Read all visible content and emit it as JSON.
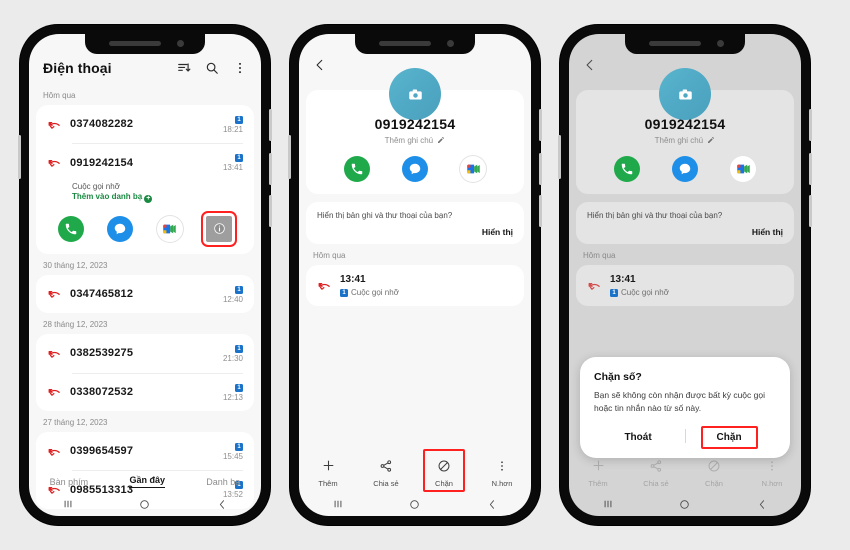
{
  "background_color": "#ebebeb",
  "accent": {
    "green": "#1fa94b",
    "blue": "#1e8fe8",
    "teal_avatar": "#4fa8c4",
    "red_highlight": "#ff2020",
    "sim_badge_blue": "#1a73c8",
    "add_contact_green": "#1a8a42"
  },
  "phone1": {
    "app_title": "Điện thoại",
    "header_icons": [
      "sort-icon",
      "search-icon",
      "overflow-menu-icon"
    ],
    "groups": [
      {
        "date": "Hôm qua",
        "entries": [
          {
            "number": "0374082282",
            "sim": "1",
            "time": "18:21",
            "type": "missed-call-icon",
            "expanded": false
          },
          {
            "number": "0919242154",
            "sim": "1",
            "time": "13:41",
            "type": "missed-call-icon",
            "expanded": true,
            "sub_label": "Cuộc gọi nhỡ",
            "add_contact": "Thêm vào danh bạ",
            "actions": [
              "call-icon",
              "message-icon",
              "google-meet-icon",
              "info-icon"
            ],
            "highlighted_action": "info-icon"
          }
        ]
      },
      {
        "date": "30 tháng 12, 2023",
        "entries": [
          {
            "number": "0347465812",
            "sim": "1",
            "time": "12:40",
            "type": "missed-call-icon",
            "expanded": false
          }
        ]
      },
      {
        "date": "28 tháng 12, 2023",
        "entries": [
          {
            "number": "0382539275",
            "sim": "1",
            "time": "21:30",
            "type": "missed-call-icon",
            "expanded": false
          },
          {
            "number": "0338072532",
            "sim": "1",
            "time": "12:13",
            "type": "missed-call-icon",
            "expanded": false
          }
        ]
      },
      {
        "date": "27 tháng 12, 2023",
        "entries": [
          {
            "number": "0399654597",
            "sim": "1",
            "time": "15:45",
            "type": "missed-call-icon",
            "expanded": false
          },
          {
            "number": "0985513313",
            "sim": "1",
            "time": "13:52",
            "type": "missed-call-icon",
            "expanded": false
          }
        ]
      }
    ],
    "tabs": [
      {
        "label": "Bàn phím",
        "active": false
      },
      {
        "label": "Gần đây",
        "active": true
      },
      {
        "label": "Danh bạ",
        "active": false
      }
    ]
  },
  "phone2": {
    "back": "back-arrow-icon",
    "avatar_icon": "camera-icon",
    "number": "0919242154",
    "note_label": "Thêm ghi chú",
    "note_icon": "pencil-icon",
    "quick_actions": [
      "call-icon",
      "message-icon",
      "google-meet-icon"
    ],
    "voicemail_prompt": "Hiển thị bản ghi và thư thoại của bạn?",
    "voicemail_button": "Hiển thị",
    "log_date": "Hôm qua",
    "log_time": "13:41",
    "log_type": "Cuộc gọi nhỡ",
    "log_sim": "1",
    "bottom_actions": [
      {
        "label": "Thêm",
        "icon": "plus-icon",
        "highlighted": false
      },
      {
        "label": "Chia sẻ",
        "icon": "share-icon",
        "highlighted": false
      },
      {
        "label": "Chặn",
        "icon": "block-icon",
        "highlighted": true
      },
      {
        "label": "N.hơn",
        "icon": "more-vertical-icon",
        "highlighted": false
      }
    ]
  },
  "phone3": {
    "back": "back-arrow-icon",
    "avatar_icon": "camera-icon",
    "number": "0919242154",
    "note_label": "Thêm ghi chú",
    "note_icon": "pencil-icon",
    "quick_actions": [
      "call-icon",
      "message-icon",
      "google-meet-icon"
    ],
    "voicemail_prompt": "Hiển thị bản ghi và thư thoại của bạn?",
    "voicemail_button": "Hiển thị",
    "log_date": "Hôm qua",
    "log_time": "13:41",
    "log_type": "Cuộc gọi nhỡ",
    "log_sim": "1",
    "dialog": {
      "title": "Chặn số?",
      "body": "Bạn sẽ không còn nhận được bất kỳ cuộc gọi hoặc tin nhắn nào từ số này.",
      "cancel_label": "Thoát",
      "confirm_label": "Chặn",
      "highlighted_button": "Chặn"
    }
  }
}
